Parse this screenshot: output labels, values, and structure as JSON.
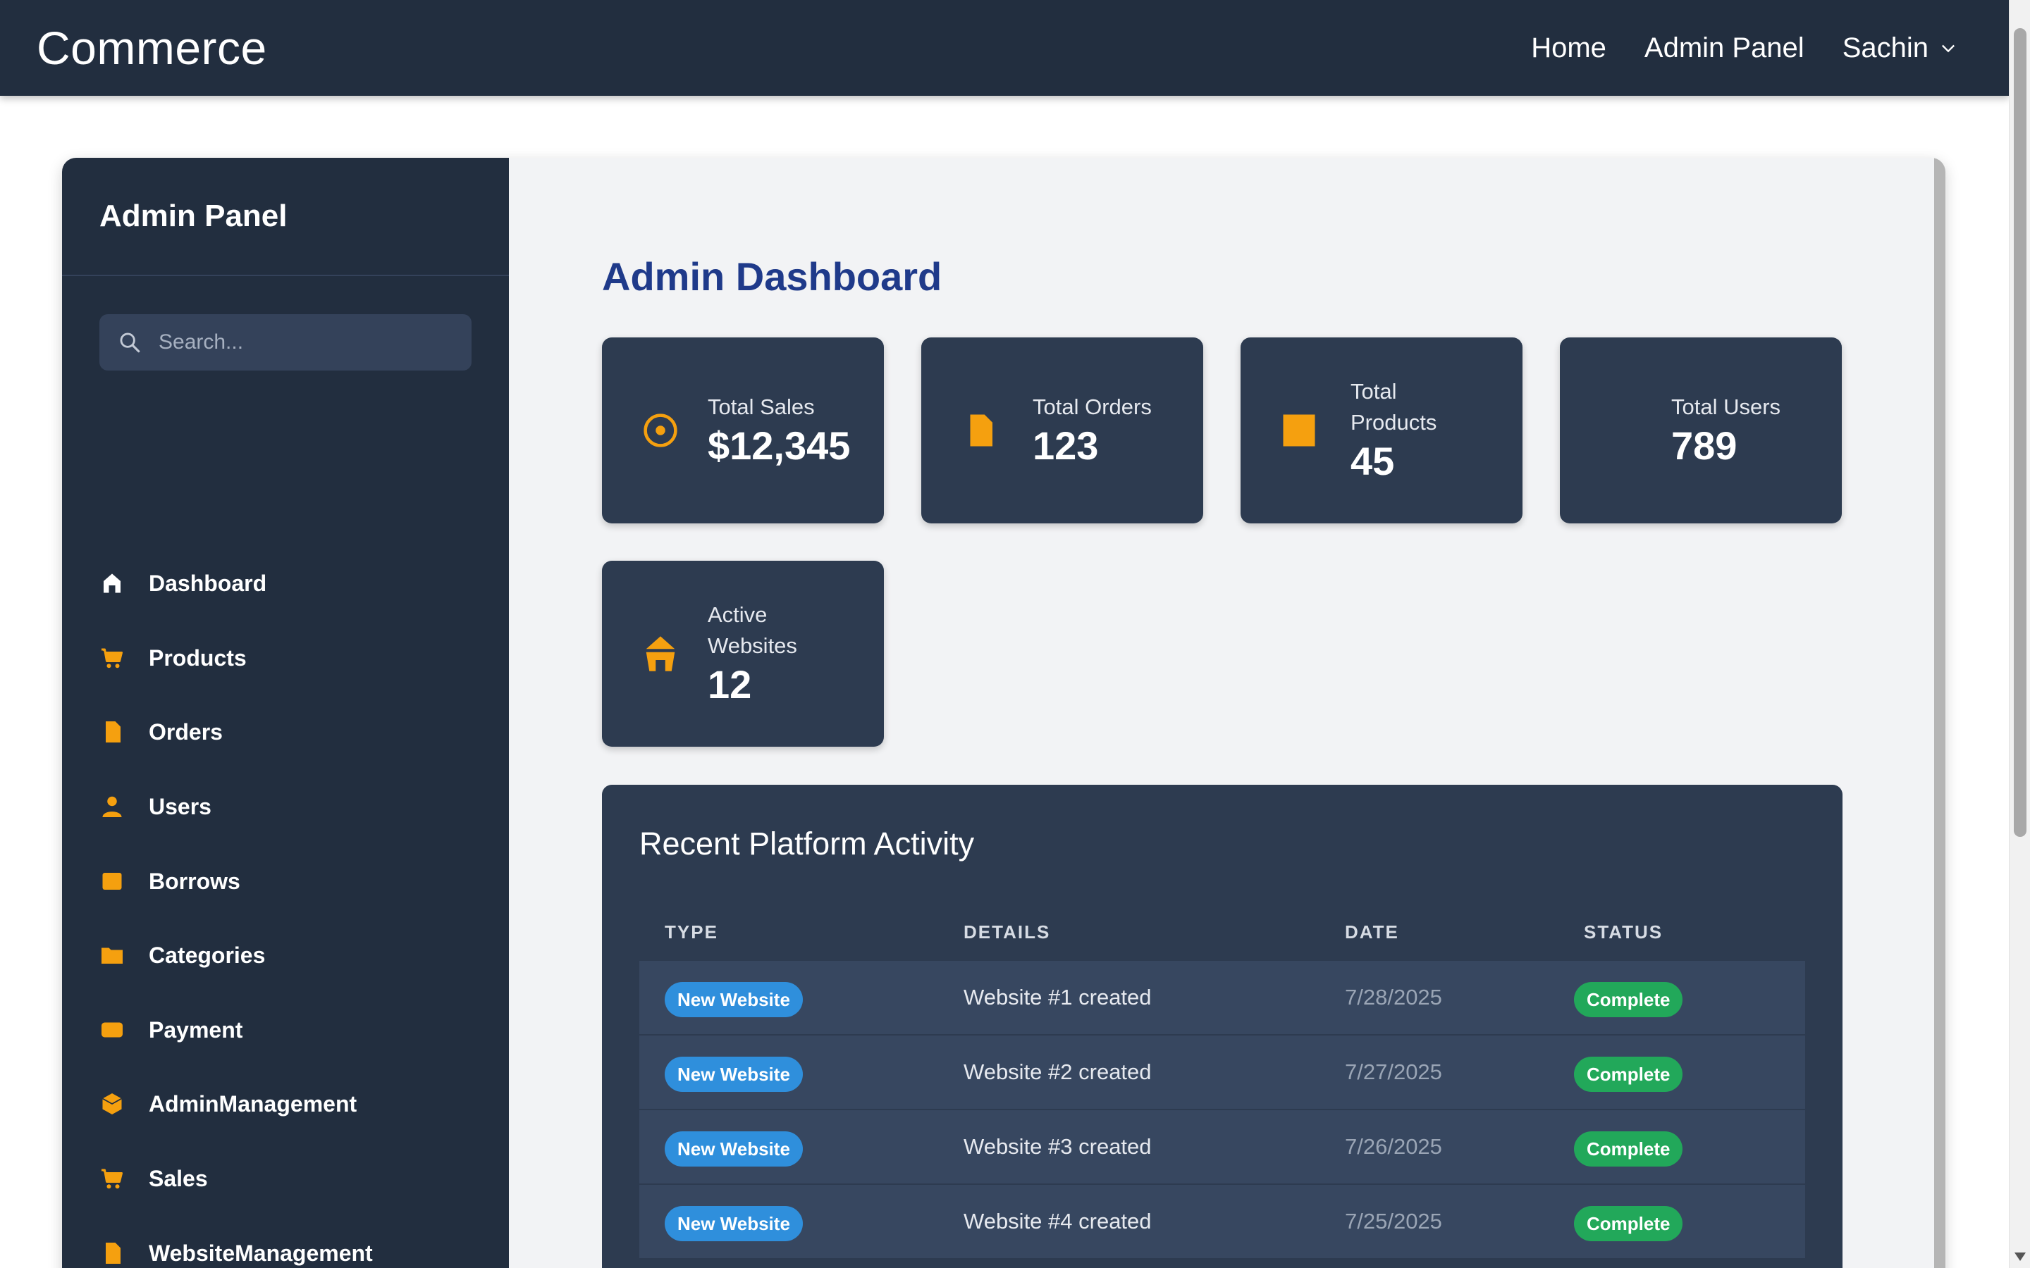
{
  "navbar": {
    "brand": "Commerce",
    "links": [
      "Home",
      "Admin Panel"
    ],
    "user": "Sachin"
  },
  "sidebar": {
    "title": "Admin Panel",
    "search_placeholder": "Search...",
    "items": [
      {
        "label": "Dashboard",
        "icon": "home-icon"
      },
      {
        "label": "Products",
        "icon": "cart-icon"
      },
      {
        "label": "Orders",
        "icon": "document-icon"
      },
      {
        "label": "Users",
        "icon": "user-icon"
      },
      {
        "label": "Borrows",
        "icon": "square-icon"
      },
      {
        "label": "Categories",
        "icon": "folder-icon"
      },
      {
        "label": "Payment",
        "icon": "card-icon"
      },
      {
        "label": "AdminManagement",
        "icon": "hexagon-icon"
      },
      {
        "label": "Sales",
        "icon": "cart-icon"
      },
      {
        "label": "WebsiteManagement",
        "icon": "document-icon"
      }
    ]
  },
  "dashboard": {
    "title": "Admin Dashboard",
    "stats": [
      {
        "label": "Total Sales",
        "value": "$12,345",
        "icon": "target-icon"
      },
      {
        "label": "Total Orders",
        "value": "123",
        "icon": "document-icon"
      },
      {
        "label": "Total Products",
        "value": "45",
        "icon": "square-icon"
      },
      {
        "label": "Total Users",
        "value": "789",
        "icon": "none"
      },
      {
        "label": "Active Websites",
        "value": "12",
        "icon": "home-icon"
      }
    ]
  },
  "activity": {
    "title": "Recent Platform Activity",
    "columns": [
      "TYPE",
      "DETAILS",
      "DATE",
      "STATUS"
    ],
    "rows": [
      {
        "type": "New Website",
        "details": "Website #1 created",
        "date": "7/28/2025",
        "status": "Complete"
      },
      {
        "type": "New Website",
        "details": "Website #2 created",
        "date": "7/27/2025",
        "status": "Complete"
      },
      {
        "type": "New Website",
        "details": "Website #3 created",
        "date": "7/26/2025",
        "status": "Complete"
      },
      {
        "type": "New Website",
        "details": "Website #4 created",
        "date": "7/25/2025",
        "status": "Complete"
      }
    ]
  },
  "colors": {
    "navbar": "#222e3f",
    "sidebar": "#222e3f",
    "card": "#2d3b50",
    "accent_icon": "#f5a00f",
    "title_blue": "#1f3a8a",
    "type_pill": "#2f8fdc",
    "status_pill": "#22a85a"
  }
}
